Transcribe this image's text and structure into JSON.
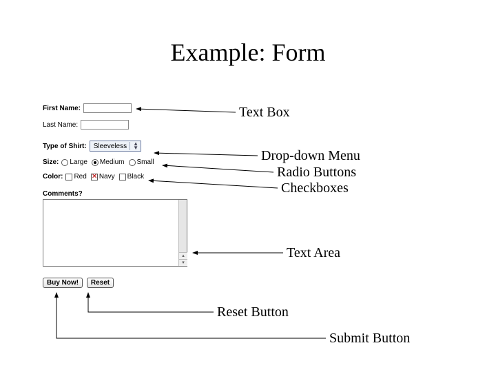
{
  "title": "Example: Form",
  "form": {
    "first_name_label": "First Name:",
    "last_name_label": "Last Name:",
    "shirt_type_label": "Type of Shirt:",
    "shirt_type_value": "Sleeveless",
    "size_label": "Size:",
    "size_options": {
      "large": "Large",
      "medium": "Medium",
      "small": "Small"
    },
    "size_selected": "medium",
    "color_label": "Color:",
    "color_options": {
      "red": "Red",
      "navy": "Navy",
      "black": "Black"
    },
    "color_selected": [
      "navy"
    ],
    "comments_label": "Comments?",
    "buy_button": "Buy Now!",
    "reset_button": "Reset"
  },
  "annotations": {
    "text_box": "Text Box",
    "dropdown": "Drop-down Menu",
    "radios": "Radio Buttons",
    "checkboxes": "Checkboxes",
    "textarea": "Text Area",
    "reset": "Reset Button",
    "submit": "Submit Button"
  }
}
